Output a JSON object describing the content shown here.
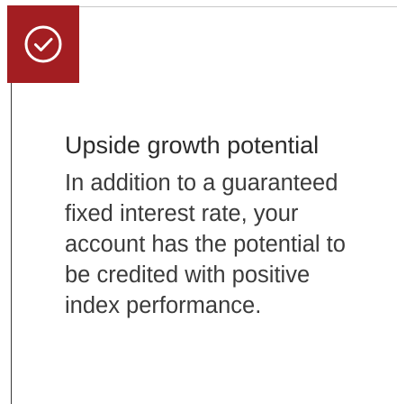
{
  "card": {
    "icon": "check-circle-icon",
    "accent_color": "#a31e22",
    "title": "Upside growth potential",
    "body": "In addition to a guaranteed fixed interest rate, your account has the potential to be credited with positive index performance."
  }
}
